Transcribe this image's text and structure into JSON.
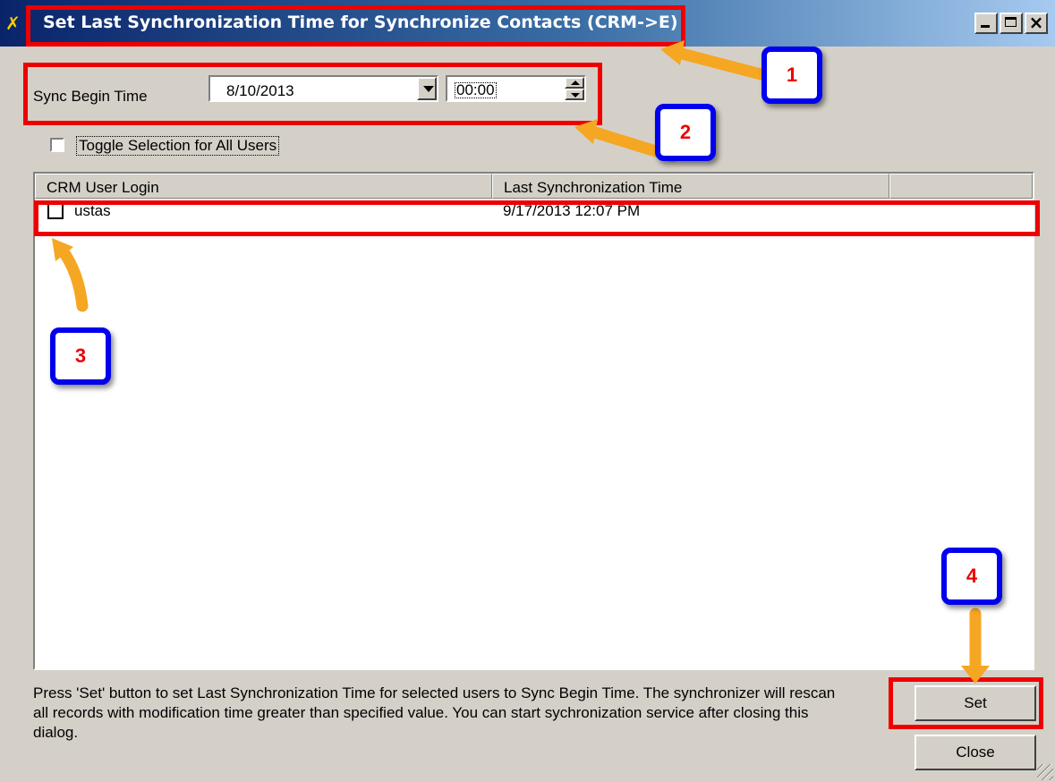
{
  "window": {
    "title": "Set Last Synchronization Time for Synchronize Contacts (CRM->E)"
  },
  "sync": {
    "label": "Sync Begin Time",
    "date_value": "8/10/2013",
    "time_value": "00:00"
  },
  "toggle": {
    "label": "Toggle Selection for All Users",
    "checked": false
  },
  "table": {
    "columns": [
      "CRM User Login",
      "Last Synchronization Time",
      ""
    ],
    "rows": [
      {
        "checked": false,
        "login": "ustas",
        "last_sync": "9/17/2013 12:07 PM"
      }
    ]
  },
  "info": {
    "text": "Press 'Set' button to set Last Synchronization Time for selected users to Sync Begin Time. The synchronizer will rescan all records with modification time greater than specified value. You can start sychronization service after closing this dialog."
  },
  "buttons": {
    "set": "Set",
    "close": "Close"
  },
  "annotations": {
    "badges": [
      "1",
      "2",
      "3",
      "4"
    ],
    "badge_border_color": "#0000ee",
    "badge_text_color": "#ee0000",
    "highlight_color": "#ee0000",
    "arrow_color": "#f5a623"
  }
}
